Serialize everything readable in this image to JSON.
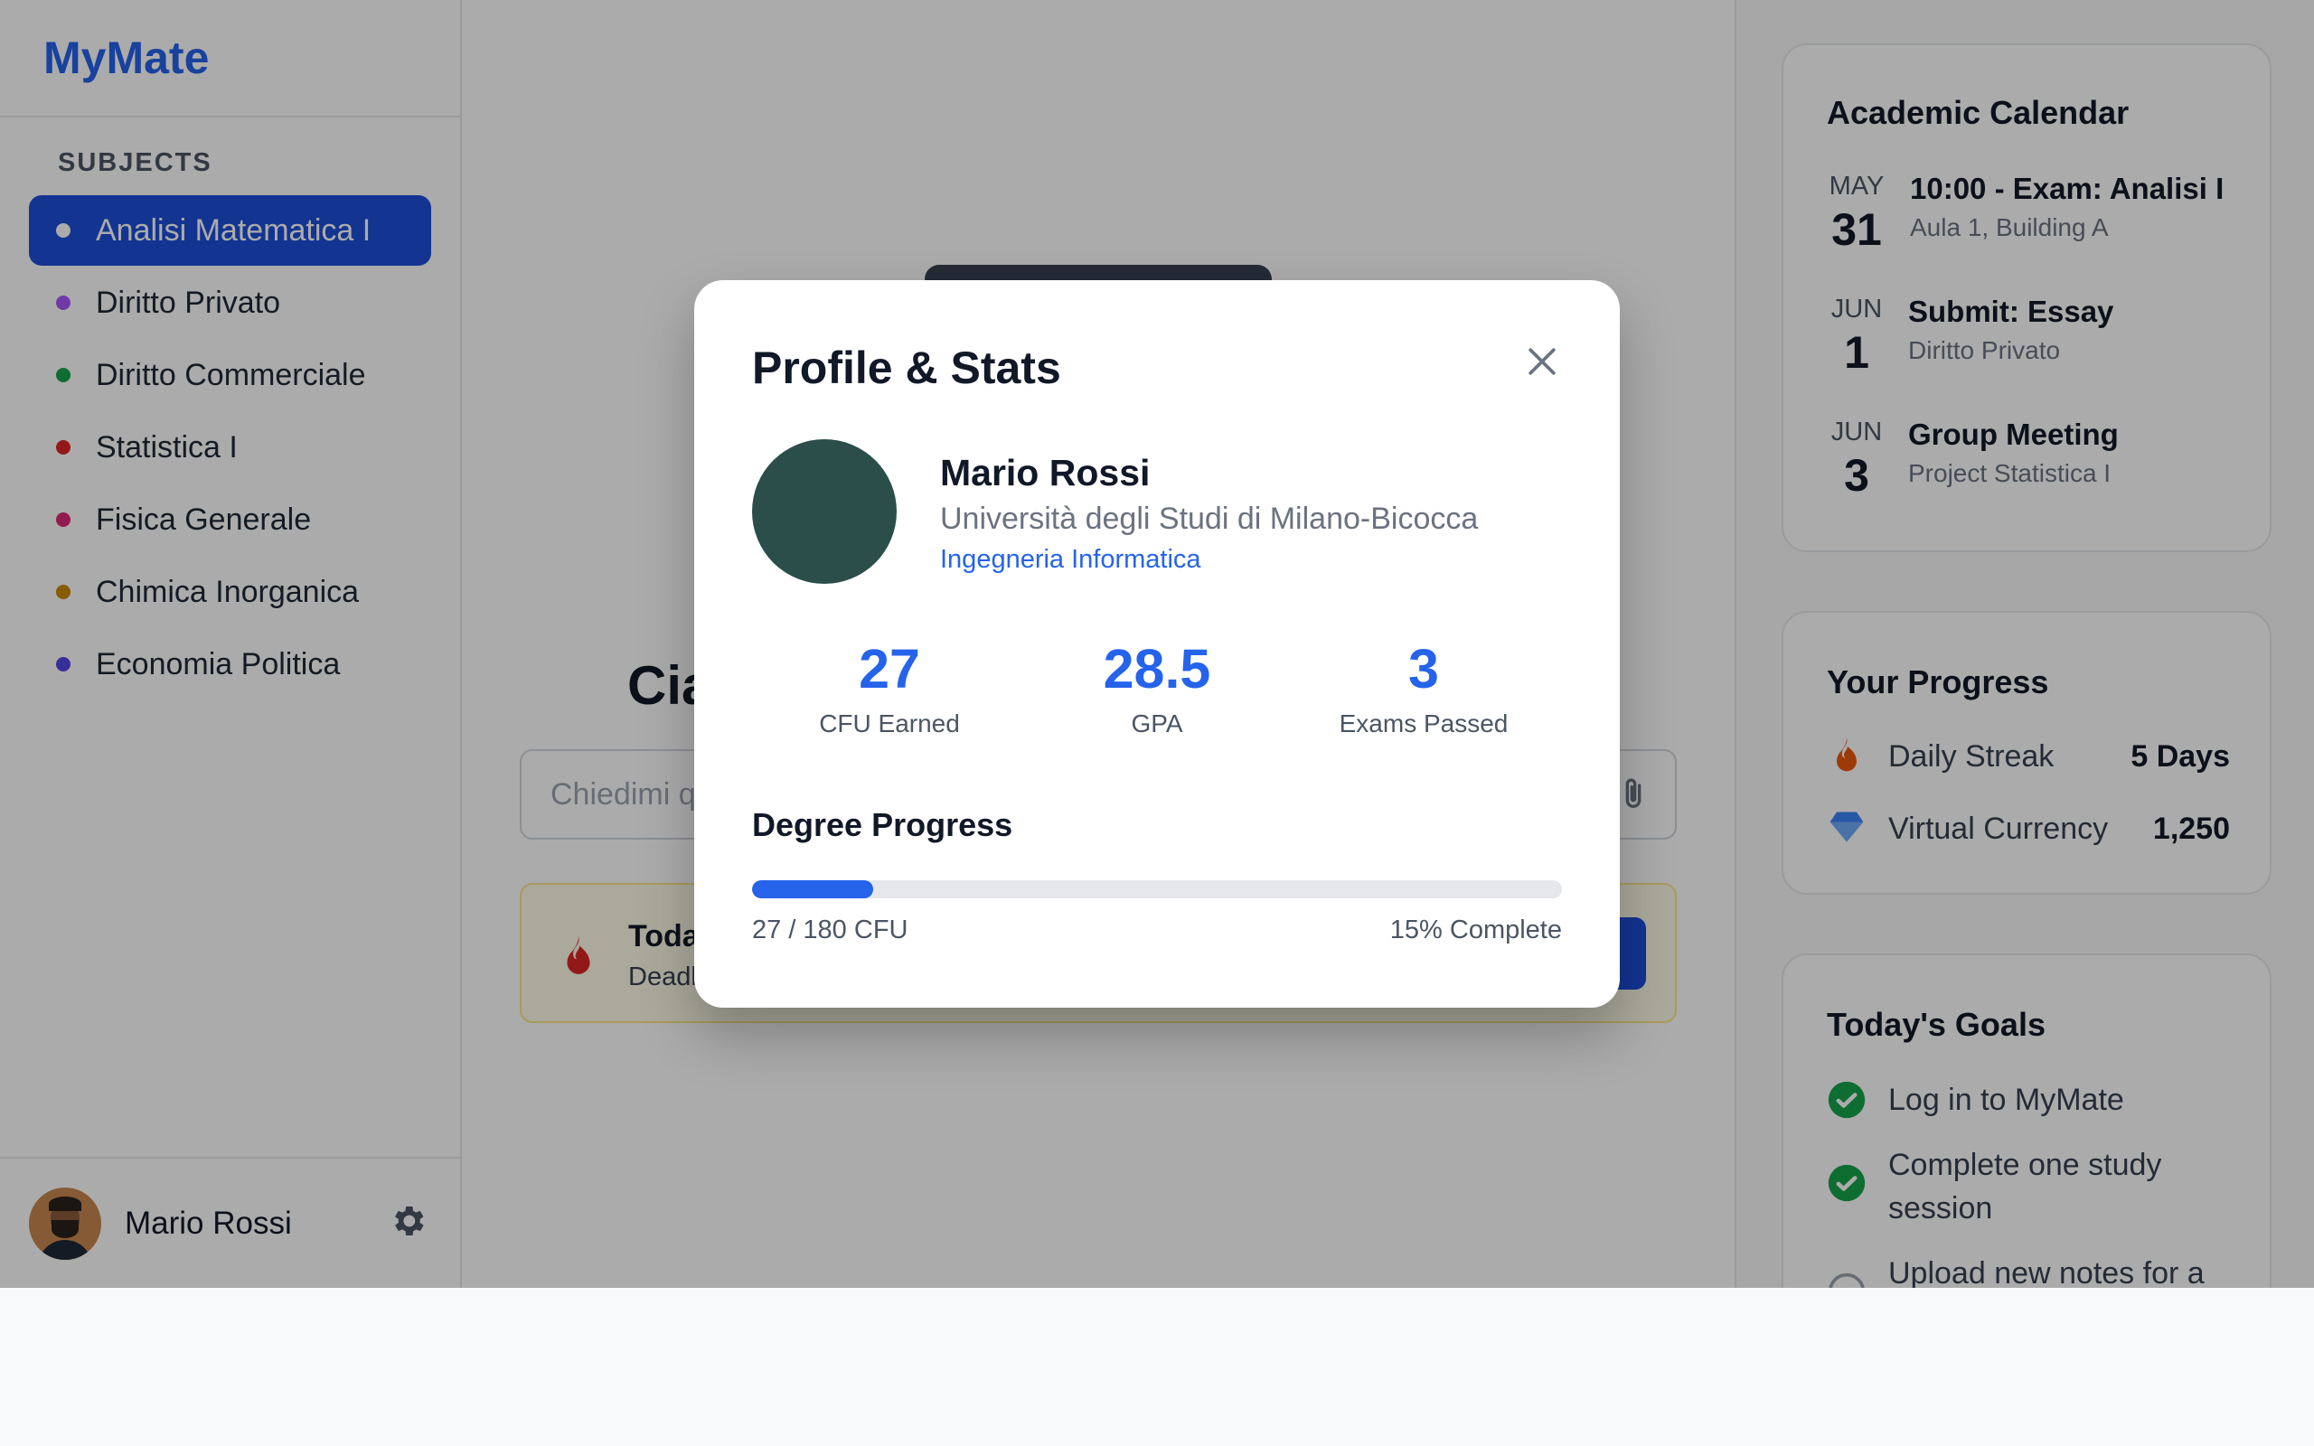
{
  "app": {
    "brand": "MyMate"
  },
  "sidebar": {
    "section_label": "SUBJECTS",
    "items": [
      {
        "label": "Analisi Matematica I",
        "color": "#ffffff",
        "active": true
      },
      {
        "label": "Diritto Privato",
        "color": "#a855f7"
      },
      {
        "label": "Diritto Commerciale",
        "color": "#16a34a"
      },
      {
        "label": "Statistica I",
        "color": "#dc2626"
      },
      {
        "label": "Fisica Generale",
        "color": "#db2777"
      },
      {
        "label": "Chimica Inorganica",
        "color": "#ca8a04"
      },
      {
        "label": "Economia Politica",
        "color": "#4f46e5"
      }
    ],
    "user": {
      "name": "Mario Rossi",
      "avatar_icon": "user-avatar",
      "settings_icon": "gear-icon"
    }
  },
  "main": {
    "greeting": "Cia",
    "chat_placeholder": "Chiedimi q",
    "alert": {
      "title": "Toda",
      "subtitle": "Deadl"
    }
  },
  "calendar": {
    "title": "Academic Calendar",
    "events": [
      {
        "month": "MAY",
        "day": "31",
        "title": "10:00 - Exam: Analisi I",
        "subtitle": "Aula 1, Building A"
      },
      {
        "month": "JUN",
        "day": "1",
        "title": "Submit: Essay",
        "subtitle": "Diritto Privato"
      },
      {
        "month": "JUN",
        "day": "3",
        "title": "Group Meeting",
        "subtitle": "Project Statistica I"
      }
    ]
  },
  "progress": {
    "title": "Your Progress",
    "rows": [
      {
        "label": "Daily Streak",
        "value": "5 Days",
        "icon": "flame-icon"
      },
      {
        "label": "Virtual Currency",
        "value": "1,250",
        "icon": "diamond-icon"
      }
    ]
  },
  "goals": {
    "title": "Today's Goals",
    "items": [
      {
        "label": "Log in to MyMate",
        "done": true
      },
      {
        "label": "Complete one study session",
        "done": true
      },
      {
        "label": "Upload new notes for a",
        "done": false
      }
    ]
  },
  "modal": {
    "title": "Profile & Stats",
    "name": "Mario Rossi",
    "university": "Università degli Studi di Milano-Bicocca",
    "course": "Ingegneria Informatica",
    "stats": [
      {
        "value": "27",
        "label": "CFU Earned"
      },
      {
        "value": "28.5",
        "label": "GPA"
      },
      {
        "value": "3",
        "label": "Exams Passed"
      }
    ],
    "degree_progress": {
      "title": "Degree Progress",
      "left": "27 / 180 CFU",
      "right": "15% Complete",
      "fraction": 0.15
    },
    "colors": {
      "accent": "#2563eb",
      "avatar_bg": "#2b4e4a"
    }
  }
}
